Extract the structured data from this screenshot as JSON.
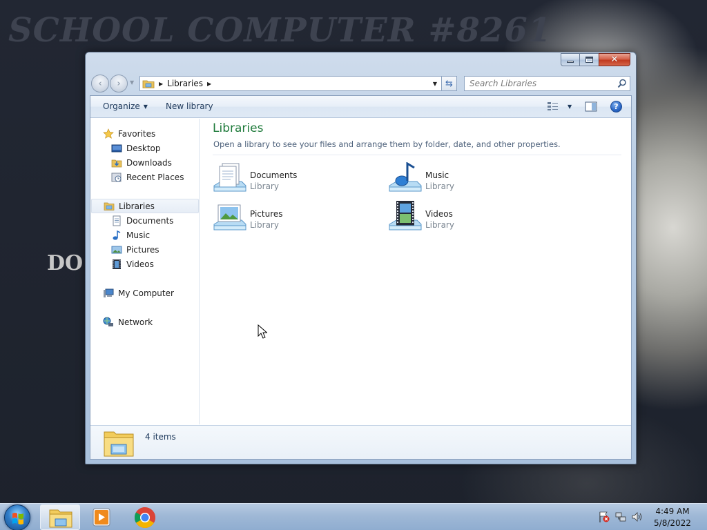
{
  "wallpaper": {
    "title": "SCHOOL COMPUTER #8261",
    "side_text": "DO"
  },
  "window": {
    "address": {
      "location": "Libraries"
    },
    "search": {
      "placeholder": "Search Libraries"
    },
    "toolbar": {
      "organize_label": "Organize",
      "new_library_label": "New library"
    },
    "nav_pane": {
      "favorites": {
        "label": "Favorites",
        "items": [
          "Desktop",
          "Downloads",
          "Recent Places"
        ]
      },
      "libraries": {
        "label": "Libraries",
        "items": [
          "Documents",
          "Music",
          "Pictures",
          "Videos"
        ]
      },
      "computer_label": "My Computer",
      "network_label": "Network"
    },
    "content": {
      "title": "Libraries",
      "subtitle": "Open a library to see your files and arrange them by folder, date, and other properties.",
      "libraries": [
        {
          "name": "Documents",
          "type": "Library",
          "icon": "documents-library-icon"
        },
        {
          "name": "Music",
          "type": "Library",
          "icon": "music-library-icon"
        },
        {
          "name": "Pictures",
          "type": "Library",
          "icon": "pictures-library-icon"
        },
        {
          "name": "Videos",
          "type": "Library",
          "icon": "videos-library-icon"
        }
      ]
    },
    "details": {
      "item_count": "4 items"
    }
  },
  "taskbar": {
    "pinned": [
      "windows-explorer-icon",
      "media-player-icon",
      "chrome-icon"
    ],
    "clock": {
      "time": "4:49 AM",
      "date": "5/8/2022"
    }
  },
  "colors": {
    "library_title": "#1e7a3a",
    "link_text": "#1e395b",
    "selection": "#e6edf6"
  }
}
